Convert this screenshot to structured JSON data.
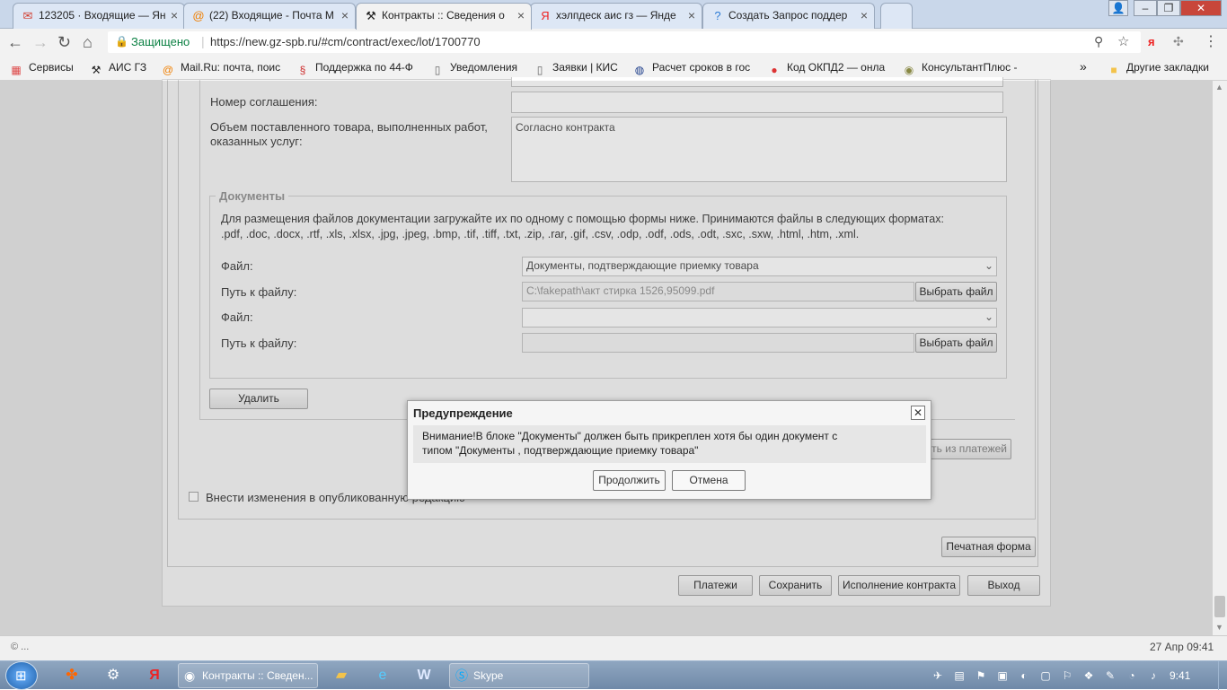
{
  "tabs": [
    {
      "icon": "gmail-icon",
      "glyph": "✉",
      "color": "#d23f31",
      "title": "123205 · Входящие — Ян"
    },
    {
      "icon": "mailru-icon",
      "glyph": "@",
      "color": "#f07f00",
      "title": "(22) Входящие - Почта М"
    },
    {
      "icon": "gavel-icon",
      "glyph": "⚒",
      "color": "#555",
      "title": "Контракты :: Сведения о"
    },
    {
      "icon": "yandex-icon",
      "glyph": "Я",
      "color": "#e22",
      "title": "хэлпдеск аис гз — Янде"
    },
    {
      "icon": "help-icon",
      "glyph": "?",
      "color": "#2a7ad5",
      "title": "Создать Запрос поддер"
    }
  ],
  "address": {
    "secure_label": "Защищено",
    "url": "https://new.gz-spb.ru/#cm/contract/exec/lot/1700770"
  },
  "bookmarks": [
    {
      "label": "Сервисы",
      "icon": "apps-icon",
      "glyph": "▦",
      "color": "#d44"
    },
    {
      "label": "АИС ГЗ",
      "icon": "gavel-icon",
      "glyph": "⚒",
      "color": "#555"
    },
    {
      "label": "Mail.Ru: почта, поис",
      "icon": "mailru-icon",
      "glyph": "@",
      "color": "#f07f00"
    },
    {
      "label": "Поддержка по 44-Ф",
      "icon": "law-icon",
      "glyph": "§",
      "color": "#c22"
    },
    {
      "label": "Уведомления",
      "icon": "page-icon",
      "glyph": "▯",
      "color": "#666"
    },
    {
      "label": "Заявки | КИС",
      "icon": "page-icon",
      "glyph": "▯",
      "color": "#666"
    },
    {
      "label": "Расчет сроков в гос",
      "icon": "calc-icon",
      "glyph": "◍",
      "color": "#1b3c8a"
    },
    {
      "label": "Код ОКПД2 — онла",
      "icon": "code-icon",
      "glyph": "●",
      "color": "#d33"
    },
    {
      "label": "КонсультантПлюс -",
      "icon": "consultant-icon",
      "glyph": "◉",
      "color": "#884"
    }
  ],
  "bookmarks_more": "»",
  "other_bookmarks": "Другие закладки",
  "form": {
    "agreement_label": "Номер соглашения:",
    "volume_label_1": "Объем поставленного товара, выполненных работ,",
    "volume_label_2": "оказанных услуг:",
    "volume_value": "Согласно контракта",
    "docs_legend": "Документы",
    "docs_hint_1": "Для размещения файлов документации загружайте их по одному с помощью формы ниже. Принимаются файлы в следующих форматах:",
    "docs_hint_2": ".pdf, .doc, .docx, .rtf, .xls, .xlsx, .jpg, .jpeg, .bmp, .tif, .tiff, .txt, .zip, .rar, .gif, .csv, .odp, .odf, .ods, .odt, .sxc, .sxw, .html, .htm, .xml.",
    "file_label": "Файл:",
    "path_label": "Путь к файлу:",
    "file1_value": "Документы, подтверждающие приемку товара",
    "path1_value": "C:\\fakepath\\акт стирка 1526,95099.pdf",
    "file2_value": "",
    "path2_value": "",
    "choose_file": "Выбрать файл",
    "delete_button": "Удалить",
    "exclude_payments": "ть из платежей",
    "publish_checkbox_label": "Внести изменения в опубликованную редакцию"
  },
  "footer_buttons": {
    "print": "Печатная форма",
    "payments": "Платежи",
    "save": "Сохранить",
    "execution": "Исполнение контракта",
    "exit": "Выход"
  },
  "dialog": {
    "title": "Предупреждение",
    "message_1": "Внимание!В блоке \"Документы\" должен быть прикреплен хотя бы один документ с",
    "message_2": "типом \"Документы , подтверждающие приемку товара\"",
    "continue": "Продолжить",
    "cancel": "Отмена"
  },
  "status": {
    "copyright": "© ...",
    "datetime": "27 Апр 09:41"
  },
  "taskbar": {
    "chrome_window": "Контракты :: Сведен...",
    "skype_window": "Skype",
    "clock": "9:41"
  }
}
